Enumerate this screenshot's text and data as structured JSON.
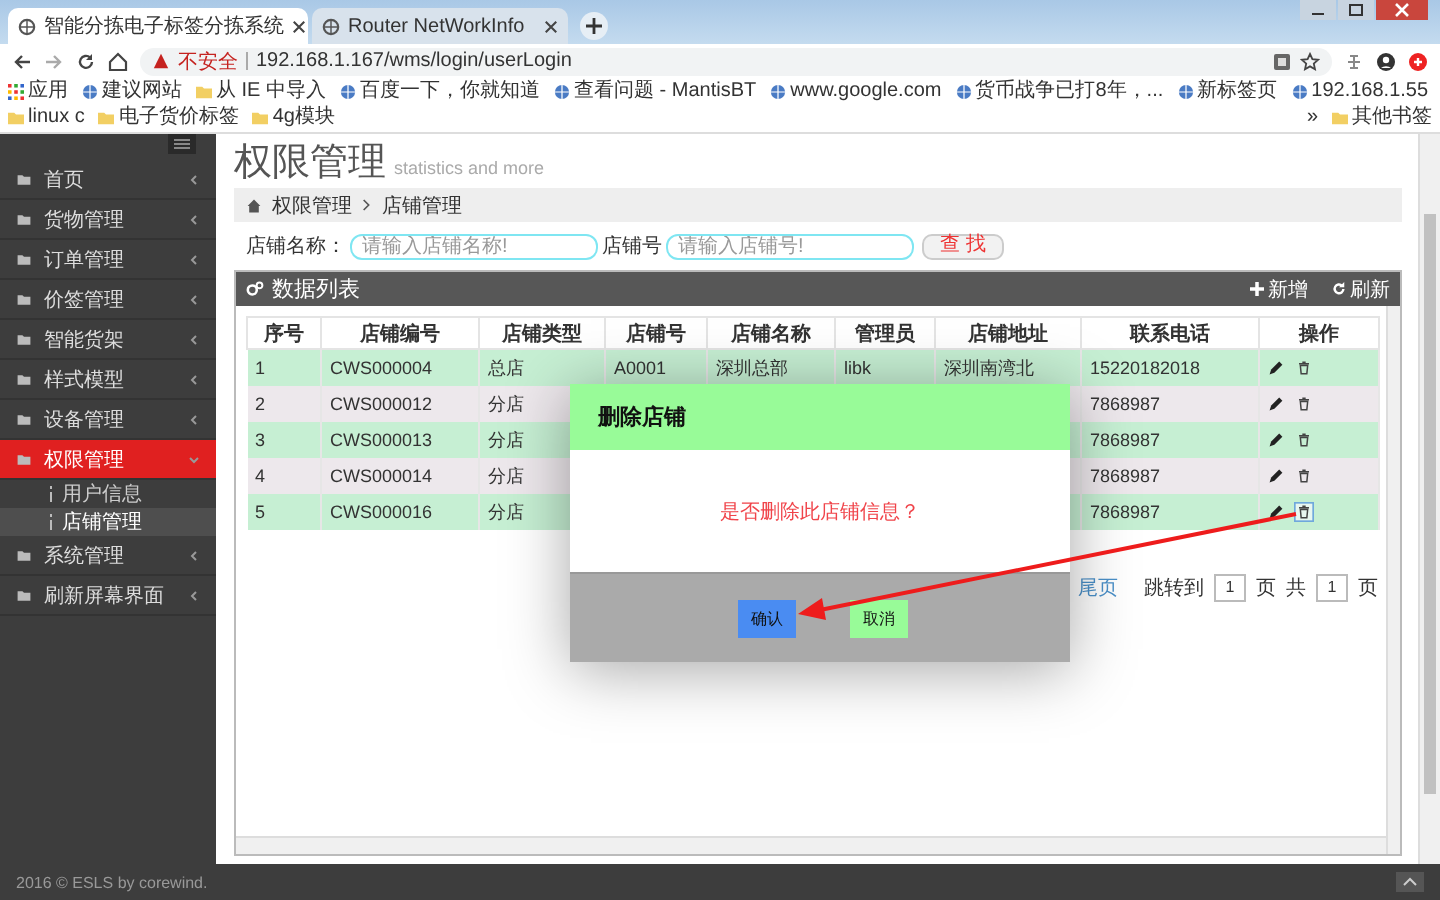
{
  "browser": {
    "tabs": [
      {
        "title": "智能分拣电子标签分拣系统",
        "selected": true
      },
      {
        "title": "Router NetWorkInfo",
        "selected": false
      }
    ],
    "security_label": "不安全",
    "url": "192.168.1.167/wms/login/userLogin",
    "bookmarks": [
      {
        "label": "应用",
        "kind": "apps"
      },
      {
        "label": "建议网站",
        "kind": "site"
      },
      {
        "label": "从 IE 中导入",
        "kind": "folder"
      },
      {
        "label": "百度一下，你就知道",
        "kind": "site"
      },
      {
        "label": "查看问题 - MantisBT",
        "kind": "site"
      },
      {
        "label": "www.google.com",
        "kind": "site"
      },
      {
        "label": "货币战争已打8年，...",
        "kind": "site"
      },
      {
        "label": "新标签页",
        "kind": "site"
      },
      {
        "label": "192.168.1.55",
        "kind": "site"
      },
      {
        "label": "linux c",
        "kind": "folder"
      },
      {
        "label": "电子货价标签",
        "kind": "folder"
      },
      {
        "label": "4g模块",
        "kind": "folder"
      }
    ],
    "more": "»",
    "other_bookmarks": "其他书签"
  },
  "sidebar": {
    "items": [
      {
        "label": "首页",
        "selected": false,
        "expanded": false
      },
      {
        "label": "货物管理",
        "selected": false,
        "expanded": false
      },
      {
        "label": "订单管理",
        "selected": false,
        "expanded": false
      },
      {
        "label": "价签管理",
        "selected": false,
        "expanded": false
      },
      {
        "label": "智能货架",
        "selected": false,
        "expanded": false
      },
      {
        "label": "样式模型",
        "selected": false,
        "expanded": false
      },
      {
        "label": "设备管理",
        "selected": false,
        "expanded": false
      },
      {
        "label": "权限管理",
        "selected": true,
        "expanded": true,
        "children": [
          {
            "label": "用户信息",
            "selected": false
          },
          {
            "label": "店铺管理",
            "selected": true
          }
        ]
      },
      {
        "label": "系统管理",
        "selected": false,
        "expanded": false
      },
      {
        "label": "刷新屏幕界面",
        "selected": false,
        "expanded": false
      }
    ]
  },
  "page": {
    "title": "权限管理",
    "subtitle": "statistics and more",
    "breadcrumb": [
      "权限管理",
      "店铺管理"
    ]
  },
  "search": {
    "fields": [
      {
        "label": "店铺名称：",
        "placeholder": "请输入店铺名称!"
      },
      {
        "label": "店铺号",
        "placeholder": "请输入店铺号!"
      }
    ],
    "button": "查 找"
  },
  "panel": {
    "title": "数据列表",
    "actions": [
      {
        "label": "新增",
        "kind": "add"
      },
      {
        "label": "刷新",
        "kind": "refresh"
      }
    ]
  },
  "table": {
    "columns": [
      "序号",
      "店铺编号",
      "店铺类型",
      "店铺号",
      "店铺名称",
      "管理员",
      "店铺地址",
      "联系电话",
      "操作"
    ],
    "rows": [
      {
        "cells": [
          "1",
          "CWS000004",
          "总店",
          "A0001",
          "深圳总部",
          "libk",
          "深圳南湾北",
          "15220182018"
        ],
        "delete_focused": false
      },
      {
        "cells": [
          "2",
          "CWS000012",
          "分店",
          null,
          null,
          null,
          null,
          "7868987"
        ],
        "delete_focused": false
      },
      {
        "cells": [
          "3",
          "CWS000013",
          "分店",
          null,
          null,
          null,
          null,
          "7868987"
        ],
        "delete_focused": false
      },
      {
        "cells": [
          "4",
          "CWS000014",
          "分店",
          null,
          null,
          null,
          null,
          "7868987"
        ],
        "delete_focused": false
      },
      {
        "cells": [
          "5",
          "CWS000016",
          "分店",
          null,
          null,
          null,
          null,
          "7868987"
        ],
        "delete_focused": true
      }
    ]
  },
  "pagination": {
    "last": "尾页",
    "jump_label": "跳转到",
    "page_value": "1",
    "page_unit": "页",
    "total_label": "共",
    "total_value": "1",
    "total_unit": "页"
  },
  "dialog": {
    "title": "删除店铺",
    "message": "是否删除此店铺信息？",
    "buttons": [
      {
        "label": "确认",
        "kind": "confirm"
      },
      {
        "label": "取消",
        "kind": "cancel"
      }
    ]
  },
  "footer": "2016 © ESLS by corewind."
}
